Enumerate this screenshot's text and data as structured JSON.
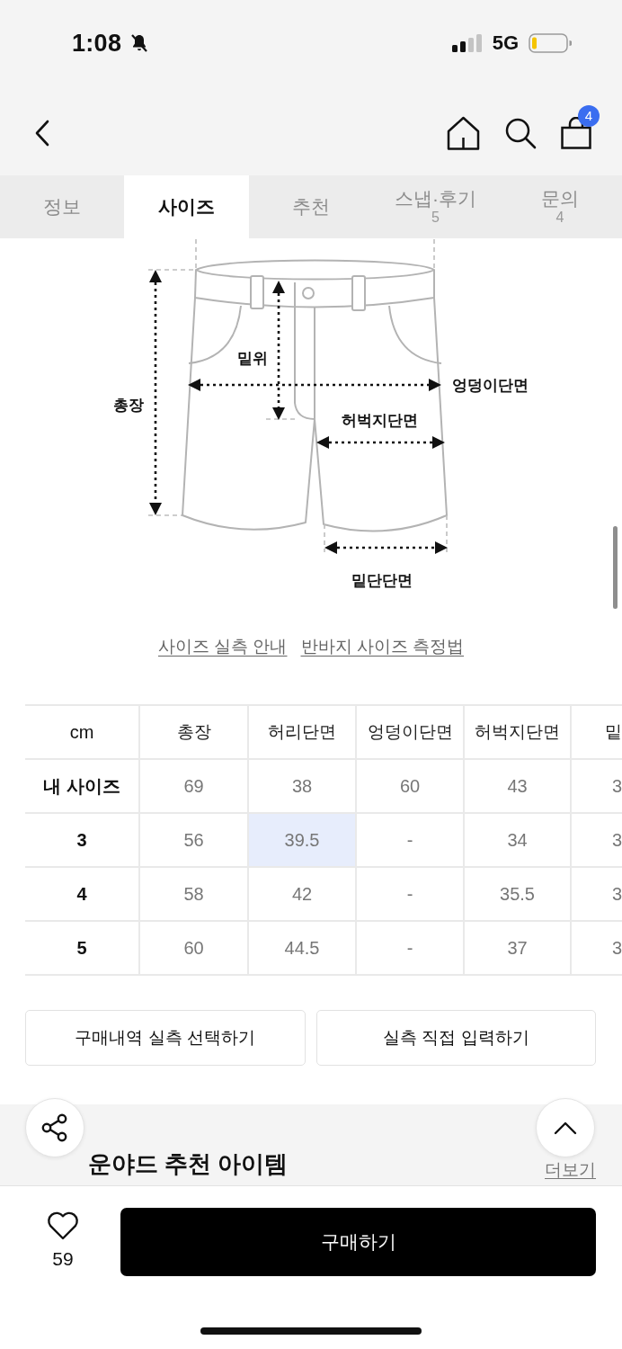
{
  "status_bar": {
    "time": "1:08",
    "network": "5G"
  },
  "nav": {
    "cart_count": "4"
  },
  "tabs": [
    {
      "label": "정보",
      "selected": false
    },
    {
      "label": "사이즈",
      "selected": true
    },
    {
      "label": "추천",
      "selected": false
    },
    {
      "label": "스냅·후기",
      "count": "5",
      "selected": false
    },
    {
      "label": "문의",
      "count": "4",
      "selected": false
    }
  ],
  "size_diagram": {
    "labels": [
      "밑위",
      "총장",
      "엉덩이단면",
      "허벅지단면",
      "밑단단면"
    ]
  },
  "guide_links": [
    "사이즈 실측 안내",
    "반바지 사이즈 측정법"
  ],
  "size_table": {
    "columns": [
      "cm",
      "총장",
      "허리단면",
      "엉덩이단면",
      "허벅지단면",
      "밑"
    ],
    "rows": [
      {
        "cells": [
          {
            "text": "내 사이즈",
            "highlighted": false
          },
          {
            "text": "69",
            "highlighted": false
          },
          {
            "text": "38",
            "highlighted": false
          },
          {
            "text": "60",
            "highlighted": false
          },
          {
            "text": "43",
            "highlighted": false
          },
          {
            "text": "3",
            "highlighted": false
          }
        ]
      },
      {
        "cells": [
          {
            "text": "3",
            "highlighted": false
          },
          {
            "text": "56",
            "highlighted": false
          },
          {
            "text": "39.5",
            "highlighted": true
          },
          {
            "text": "-",
            "highlighted": false
          },
          {
            "text": "34",
            "highlighted": false
          },
          {
            "text": "3",
            "highlighted": false
          }
        ]
      },
      {
        "cells": [
          {
            "text": "4",
            "highlighted": false
          },
          {
            "text": "58",
            "highlighted": false
          },
          {
            "text": "42",
            "highlighted": false
          },
          {
            "text": "-",
            "highlighted": false
          },
          {
            "text": "35.5",
            "highlighted": false
          },
          {
            "text": "3",
            "highlighted": false
          }
        ]
      },
      {
        "cells": [
          {
            "text": "5",
            "highlighted": false
          },
          {
            "text": "60",
            "highlighted": false
          },
          {
            "text": "44.5",
            "highlighted": false
          },
          {
            "text": "-",
            "highlighted": false
          },
          {
            "text": "37",
            "highlighted": false
          },
          {
            "text": "3",
            "highlighted": false
          }
        ]
      }
    ]
  },
  "buttons": [
    "구매내역 실측 선택하기",
    "실측 직접 입력하기"
  ],
  "recommend": {
    "title": "운야드 추천 아이템",
    "more": "더보기"
  },
  "bottom_bar": {
    "likes": "59",
    "liked": false,
    "buy": "구매하기"
  }
}
